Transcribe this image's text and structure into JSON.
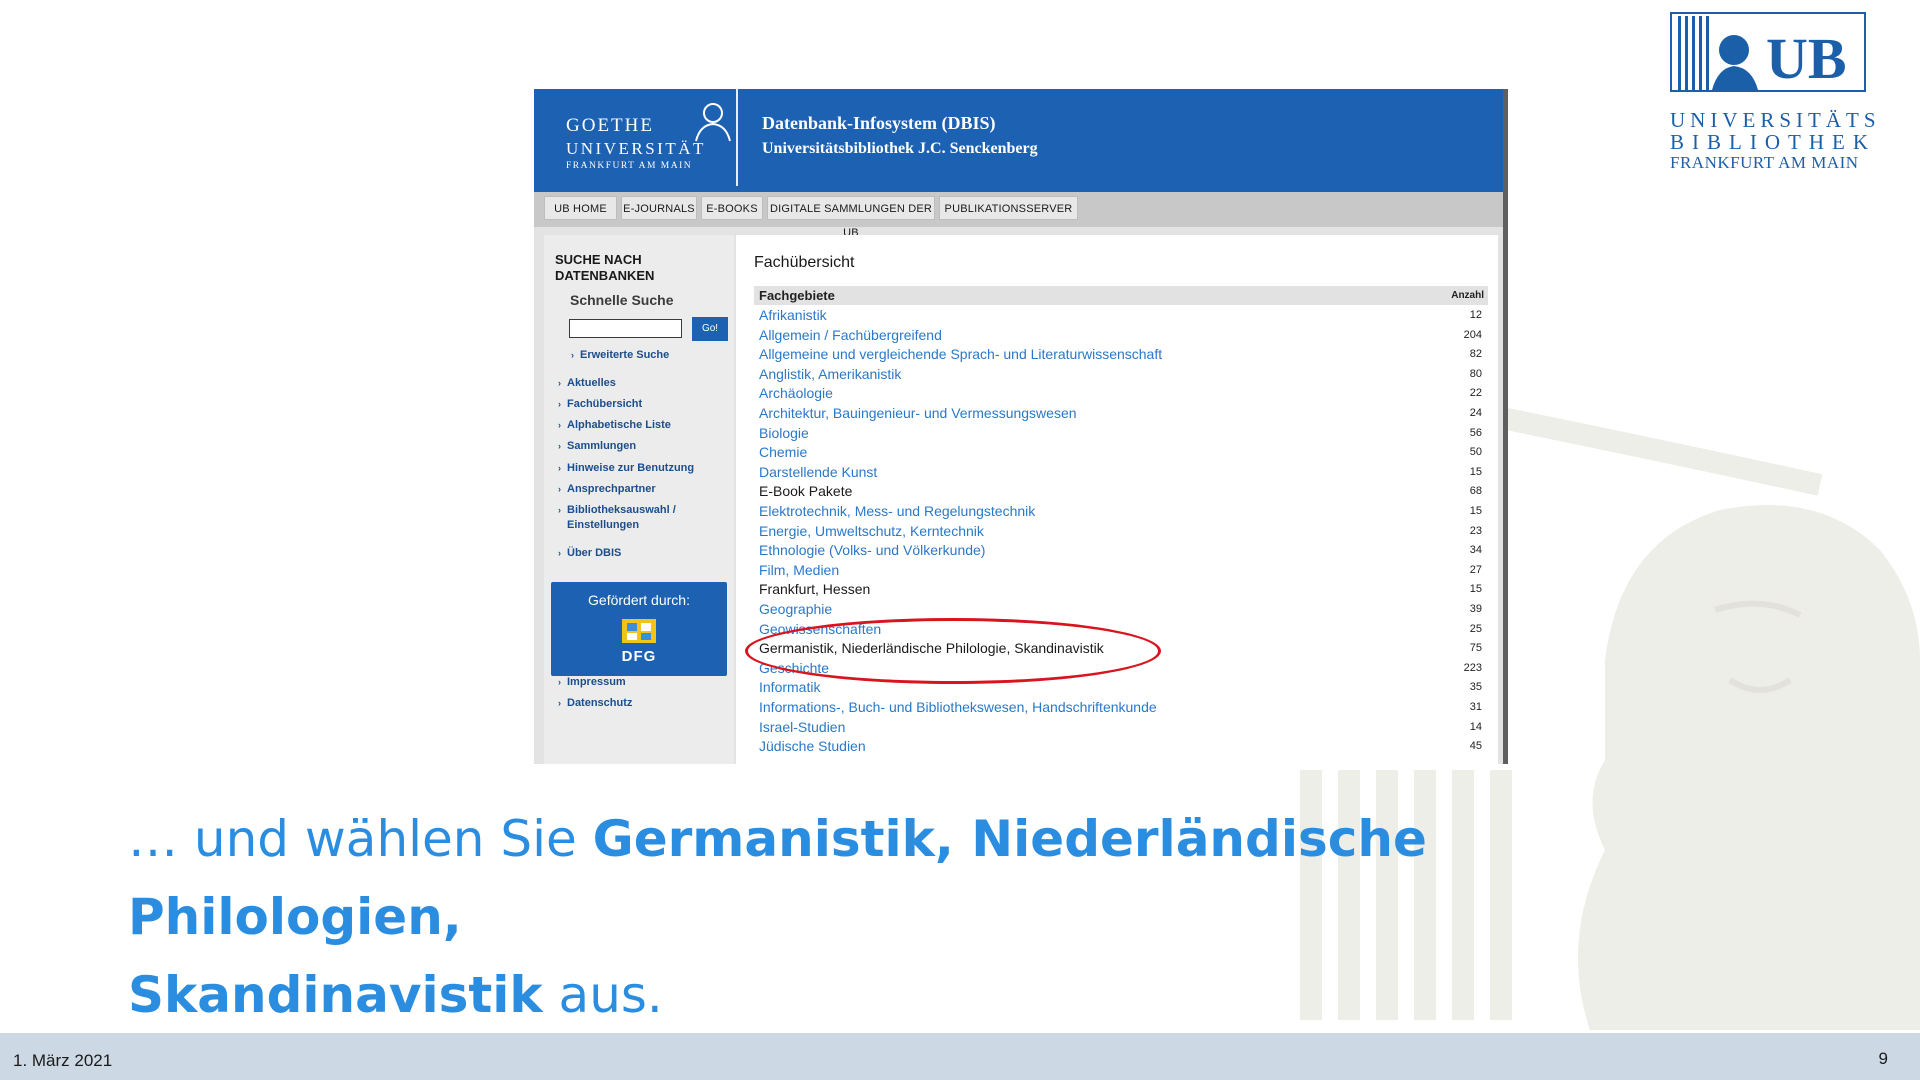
{
  "logo": {
    "line1": "UNIVERSITÄTS",
    "line2": "BIBLIOTHEK",
    "line3": "FRANKFURT AM MAIN",
    "mark_text": "UB",
    "color": "#1b5fa8"
  },
  "screenshot": {
    "goethe_logo": {
      "line1": "GOETHE",
      "line2": "UNIVERSITÄT",
      "line3": "FRANKFURT AM MAIN"
    },
    "title": "Datenbank-Infosystem (DBIS)",
    "subtitle": "Universitätsbibliothek J.C. Senckenberg",
    "nav_tabs": [
      {
        "label": "UB HOME"
      },
      {
        "label": "E-JOURNALS"
      },
      {
        "label": "E-BOOKS"
      },
      {
        "label": "DIGITALE SAMMLUNGEN DER UB"
      },
      {
        "label": "PUBLIKATIONSSERVER"
      }
    ],
    "sidebar": {
      "heading_line1": "SUCHE NACH",
      "heading_line2": "DATENBANKEN",
      "quick_search_label": "Schnelle Suche",
      "search_value": "",
      "go_label": "Go!",
      "advanced_link": "Erweiterte Suche",
      "links": [
        {
          "label": "Aktuelles"
        },
        {
          "label": "Fachübersicht"
        },
        {
          "label": "Alphabetische Liste"
        },
        {
          "label": "Sammlungen"
        },
        {
          "label": "Hinweise zur Benutzung"
        },
        {
          "label": "Ansprechpartner"
        },
        {
          "label": "Bibliotheksauswahl /"
        },
        {
          "label": "Über DBIS"
        }
      ],
      "settings_line2": "Einstellungen",
      "funded_label": "Gefördert durch:",
      "funded_logo": "DFG",
      "footer_links": [
        {
          "label": "Impressum"
        },
        {
          "label": "Datenschutz"
        }
      ]
    },
    "main": {
      "title": "Fachübersicht",
      "col_name": "Fachgebiete",
      "col_count": "Anzahl",
      "rows": [
        {
          "name": "Afrikanistik",
          "count": "12"
        },
        {
          "name": "Allgemein / Fachübergreifend",
          "count": "204"
        },
        {
          "name": "Allgemeine und vergleichende Sprach- und Literaturwissenschaft",
          "count": "82"
        },
        {
          "name": "Anglistik, Amerikanistik",
          "count": "80"
        },
        {
          "name": "Archäologie",
          "count": "22"
        },
        {
          "name": "Architektur, Bauingenieur- und Vermessungswesen",
          "count": "24"
        },
        {
          "name": "Biologie",
          "count": "56"
        },
        {
          "name": "Chemie",
          "count": "50"
        },
        {
          "name": "Darstellende Kunst",
          "count": "15"
        },
        {
          "name": "E-Book Pakete",
          "count": "68"
        },
        {
          "name": "Elektrotechnik, Mess- und Regelungstechnik",
          "count": "15"
        },
        {
          "name": "Energie, Umweltschutz, Kerntechnik",
          "count": "23"
        },
        {
          "name": "Ethnologie (Volks- und Völkerkunde)",
          "count": "34"
        },
        {
          "name": "Film, Medien",
          "count": "27"
        },
        {
          "name": "Frankfurt, Hessen",
          "count": "15"
        },
        {
          "name": "Geographie",
          "count": "39"
        },
        {
          "name": "Geowissenschaften",
          "count": "25"
        },
        {
          "name": "Germanistik, Niederländische Philologie, Skandinavistik",
          "count": "75"
        },
        {
          "name": "Geschichte",
          "count": "223"
        },
        {
          "name": "Informatik",
          "count": "35"
        },
        {
          "name": "Informations-, Buch- und Bibliothekswesen, Handschriftenkunde",
          "count": "31"
        },
        {
          "name": "Israel-Studien",
          "count": "14"
        },
        {
          "name": "Jüdische Studien",
          "count": "45"
        }
      ]
    }
  },
  "caption": {
    "prefix": "… und wählen Sie ",
    "highlight_line1": "Germanistik, Niederländische Philologien,",
    "highlight_line2": "Skandinavistik",
    "suffix": " aus.",
    "color": "#2a8de0"
  },
  "footer": {
    "date": "1. März 2021",
    "page": "9"
  },
  "colors": {
    "header_blue": "#1d61b2",
    "link_blue": "#2a78c9",
    "highlight_red": "#d8141e"
  }
}
